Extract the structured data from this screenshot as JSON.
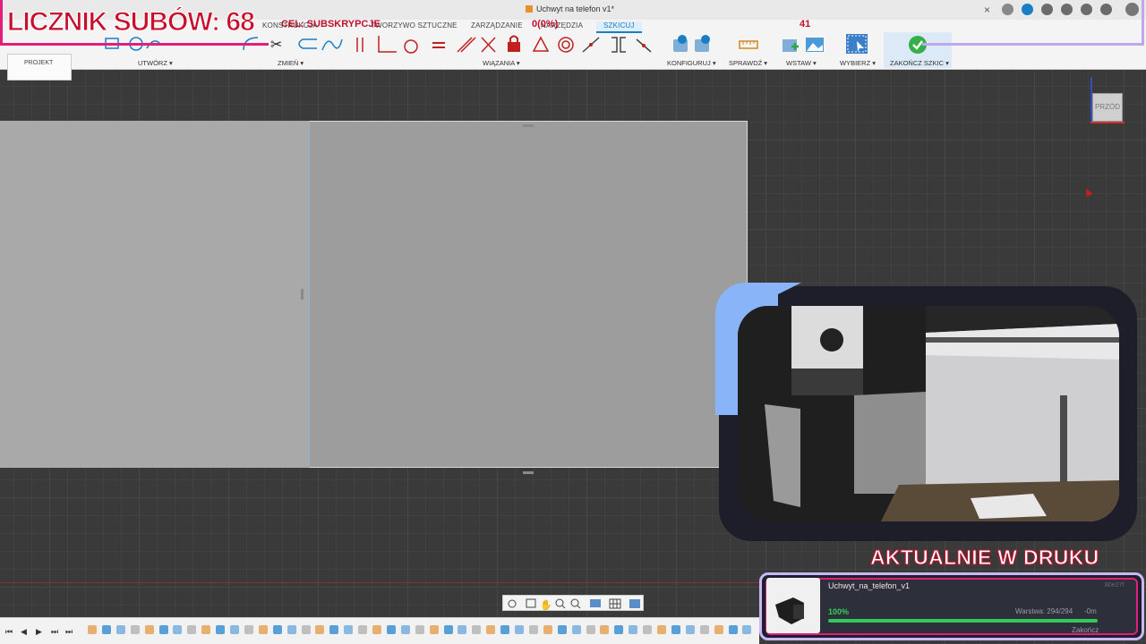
{
  "app": {
    "doc_title": "Uchwyt na telefon v1*"
  },
  "overlay": {
    "sub_counter": "LICZNIK SUBÓW: 68",
    "goal_text": "CEL: SUBSKRYPCJE",
    "mid_counter": "0(0%)",
    "count_right": "41"
  },
  "tabs": [
    {
      "label": "KONSTRUKCJA"
    },
    {
      "label": "TWORZYWO SZTUCZNE"
    },
    {
      "label": "ZARZĄDZANIE"
    },
    {
      "label": "NARZĘDZIA"
    },
    {
      "label": "SZKICUJ",
      "active": true
    }
  ],
  "ribbon": {
    "project_label": "PROJEKT",
    "groups": [
      {
        "label": "UTWÓRZ ▾"
      },
      {
        "label": "ZMIEŃ ▾"
      },
      {
        "label": "WIĄZANIA ▾"
      },
      {
        "label": "KONFIGURUJ ▾"
      },
      {
        "label": "SPRAWDŹ ▾"
      },
      {
        "label": "WSTAW ▾"
      },
      {
        "label": "WYBIERZ ▾"
      },
      {
        "label": "ZAKOŃCZ SZKIC ▾"
      }
    ]
  },
  "viewcube": {
    "label": "PRZÓD"
  },
  "print": {
    "heading": "AKTUALNIE W DRUKU",
    "job_name": "Uchwyt_na_telefon_v1",
    "percent_label": "100%",
    "progress": 1.0,
    "layer": "Warstwa: 294/294",
    "time_left": "-0m",
    "finish": "Zakończ",
    "job_id": "80e27f"
  },
  "colors": {
    "accent_blue": "#1a7ec4",
    "overlay_red": "#c8102e",
    "frame_pink": "#e0207a",
    "progress_green": "#34c85a"
  }
}
